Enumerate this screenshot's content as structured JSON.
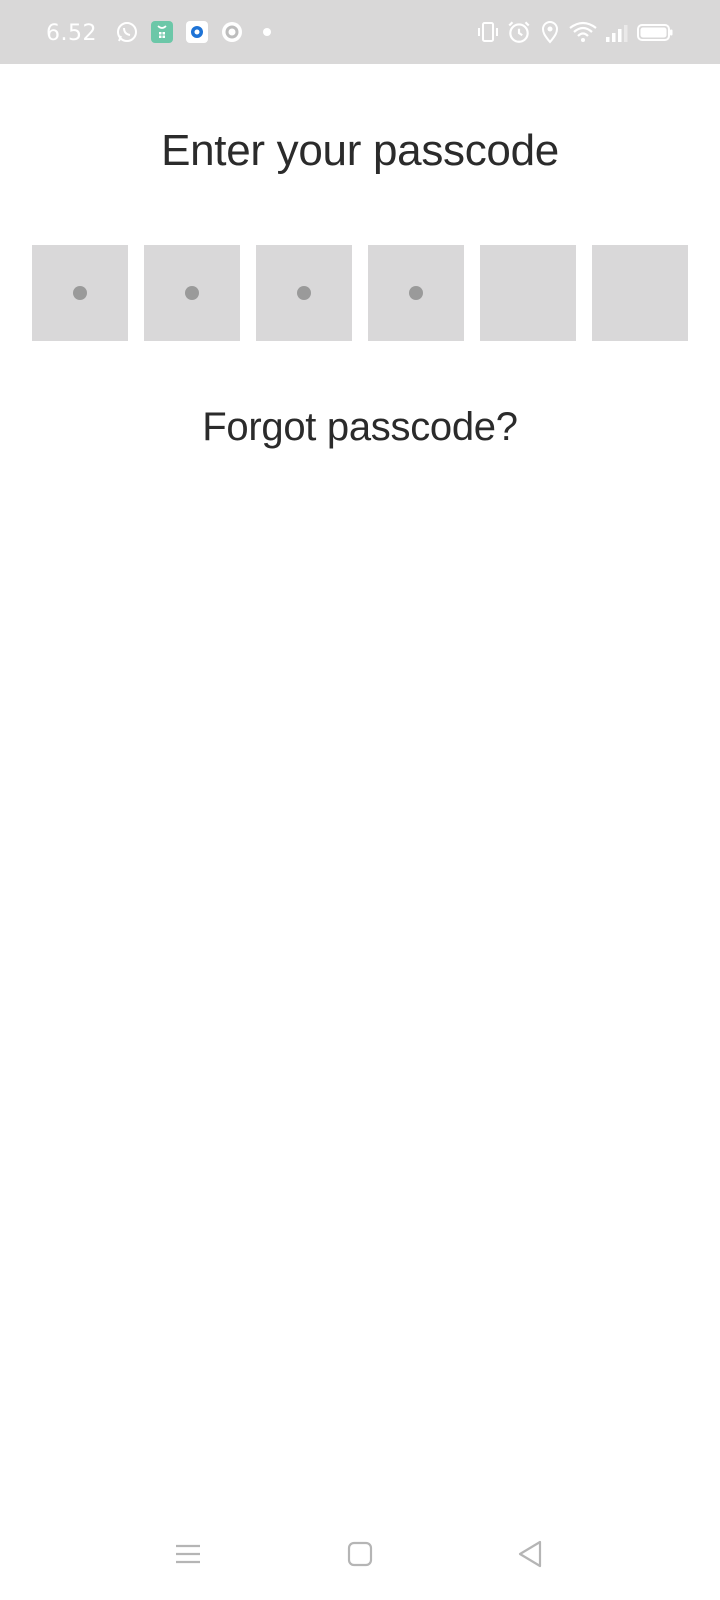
{
  "status_bar": {
    "time": "6.52",
    "left_icons": [
      "whatsapp-icon",
      "app-notification-icon",
      "blue-app-icon",
      "ring-app-icon",
      "more-dot-icon"
    ],
    "right_icons": [
      "vibrate-icon",
      "alarm-icon",
      "location-icon",
      "wifi-icon",
      "signal-icon",
      "battery-icon"
    ],
    "background": "#d9d8d8"
  },
  "screen": {
    "title": "Enter your passcode",
    "forgot_label": "Forgot passcode?"
  },
  "passcode": {
    "length": 6,
    "filled": 4,
    "box_color": "#d9d8d9",
    "dot_color": "#9a9a9a"
  },
  "nav_bar": {
    "buttons": [
      "menu-icon",
      "home-icon",
      "back-icon"
    ]
  }
}
